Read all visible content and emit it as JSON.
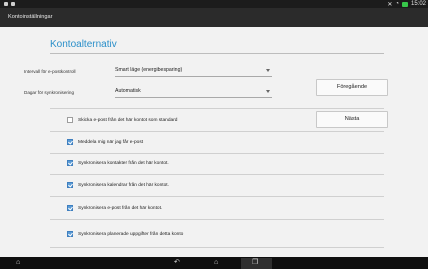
{
  "titlebar": {
    "title": "Kontoinställningar"
  },
  "page": {
    "heading": "Kontoalternativ"
  },
  "settings": {
    "interval": {
      "label": "Intervall för e-postkontroll",
      "value": "Smart läge (energibesparing)"
    },
    "sync_days": {
      "label": "Dagar för synkronisering",
      "value": "Automatisk"
    }
  },
  "buttons": {
    "previous": "Föregående",
    "next": "Nästa"
  },
  "options": [
    {
      "label": "Skicka e-post från det här kontot som standard",
      "checked": false
    },
    {
      "label": "Meddela mig när jag får e-post",
      "checked": true
    },
    {
      "label": "Synkronisera kontakter från det här kontot.",
      "checked": true
    },
    {
      "label": "Synkronisera kalendrar från det här kontot.",
      "checked": true
    },
    {
      "label": "Synkronisera e-post från det här kontot.",
      "checked": true
    },
    {
      "label": "Synkronisera planerade uppgifter från detta konto",
      "checked": true
    }
  ],
  "statusbar": {
    "time": "15:02"
  },
  "icons": {
    "nav_home": "home-icon",
    "nav_back": "back-icon",
    "nav_recent": "recent-apps-icon",
    "nav_screenshot": "screenshot-icon",
    "status": [
      "notification-icon",
      "mute-icon",
      "wifi-icon",
      "battery-icon"
    ]
  },
  "colors": {
    "accent": "#2a8fc9",
    "checkbox": "#5a9bd6",
    "titlebar": "#2b2b2b"
  }
}
